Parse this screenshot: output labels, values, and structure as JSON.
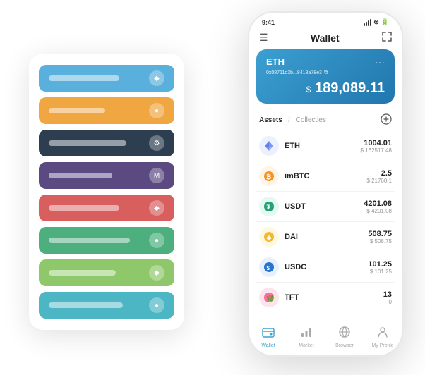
{
  "scene": {
    "background": "#ffffff"
  },
  "card_stack": {
    "items": [
      {
        "color": "card-blue",
        "text_width": "100px"
      },
      {
        "color": "card-orange",
        "text_width": "80px"
      },
      {
        "color": "card-dark",
        "text_width": "110px"
      },
      {
        "color": "card-purple",
        "text_width": "90px"
      },
      {
        "color": "card-red",
        "text_width": "100px"
      },
      {
        "color": "card-green",
        "text_width": "115px"
      },
      {
        "color": "card-light-green",
        "text_width": "95px"
      },
      {
        "color": "card-teal",
        "text_width": "105px"
      }
    ]
  },
  "phone": {
    "status_bar": {
      "time": "9:41"
    },
    "header": {
      "title": "Wallet",
      "menu_icon": "☰",
      "expand_icon": "⛶"
    },
    "eth_card": {
      "label": "ETH",
      "address": "0x08711d3b...8418a78e3",
      "more_icon": "...",
      "balance_prefix": "$",
      "balance": "189,089.11"
    },
    "assets_section": {
      "tab_active": "Assets",
      "tab_divider": "/",
      "tab_inactive": "Collecties",
      "add_icon": "⊕"
    },
    "assets": [
      {
        "symbol": "ETH",
        "name": "ETH",
        "logo_text": "♦",
        "logo_class": "logo-eth",
        "amount": "1004.01",
        "usd": "$ 162517.48"
      },
      {
        "symbol": "imBTC",
        "name": "imBTC",
        "logo_text": "₿",
        "logo_class": "logo-imbtc",
        "amount": "2.5",
        "usd": "$ 21760.1"
      },
      {
        "symbol": "USDT",
        "name": "USDT",
        "logo_text": "₮",
        "logo_class": "logo-usdt",
        "amount": "4201.08",
        "usd": "$ 4201.08"
      },
      {
        "symbol": "DAI",
        "name": "DAI",
        "logo_text": "◈",
        "logo_class": "logo-dai",
        "amount": "508.75",
        "usd": "$ 508.75"
      },
      {
        "symbol": "USDC",
        "name": "USDC",
        "logo_text": "©",
        "logo_class": "logo-usdc",
        "amount": "101.25",
        "usd": "$ 101.25"
      },
      {
        "symbol": "TFT",
        "name": "TFT",
        "logo_text": "🌿",
        "logo_class": "logo-tft",
        "amount": "13",
        "usd": "0"
      }
    ],
    "bottom_nav": [
      {
        "label": "Wallet",
        "icon": "👛",
        "active": true
      },
      {
        "label": "Market",
        "icon": "📊",
        "active": false
      },
      {
        "label": "Browser",
        "icon": "🌐",
        "active": false
      },
      {
        "label": "My Profile",
        "icon": "👤",
        "active": false
      }
    ]
  }
}
